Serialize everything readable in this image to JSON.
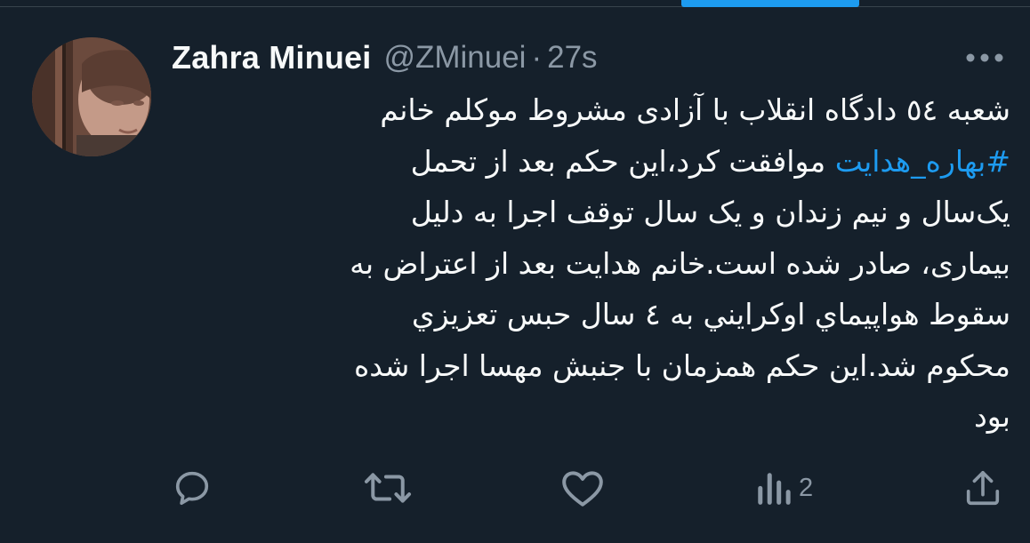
{
  "tweet": {
    "author_name": "Zahra Minuei",
    "handle": "@ZMinuei",
    "separator": "·",
    "timestamp": "27s",
    "body_lines": [
      "شعبه ٥٤ دادگاه انقلاب با آزادی مشروط موکلم خانم",
      "",
      "یک‌سال و نیم زندان و یک سال توقف اجرا به دلیل",
      "بیماری، صادر شده است.خانم هدایت بعد از اعتراض به",
      "سقوط هواپیماي اوکرایني به ٤ سال حبس تعزیزي",
      "محکوم شد.این حکم همزمان با جنبش مهسا اجرا شده",
      "بود"
    ],
    "line2": {
      "hashtag": "#بهاره_هدایت",
      "rest": "  موافقت کرد،این حکم بعد از تحمل"
    }
  },
  "actions": {
    "reply_icon": "reply-icon",
    "retweet_icon": "retweet-icon",
    "like_icon": "heart-icon",
    "views_icon": "views-icon",
    "views_count": "2",
    "share_icon": "share-icon"
  },
  "colors": {
    "background": "#15202b",
    "text": "#f7f9f9",
    "secondary": "#8b98a5",
    "accent": "#1d9bf0",
    "divider": "#38444d"
  }
}
